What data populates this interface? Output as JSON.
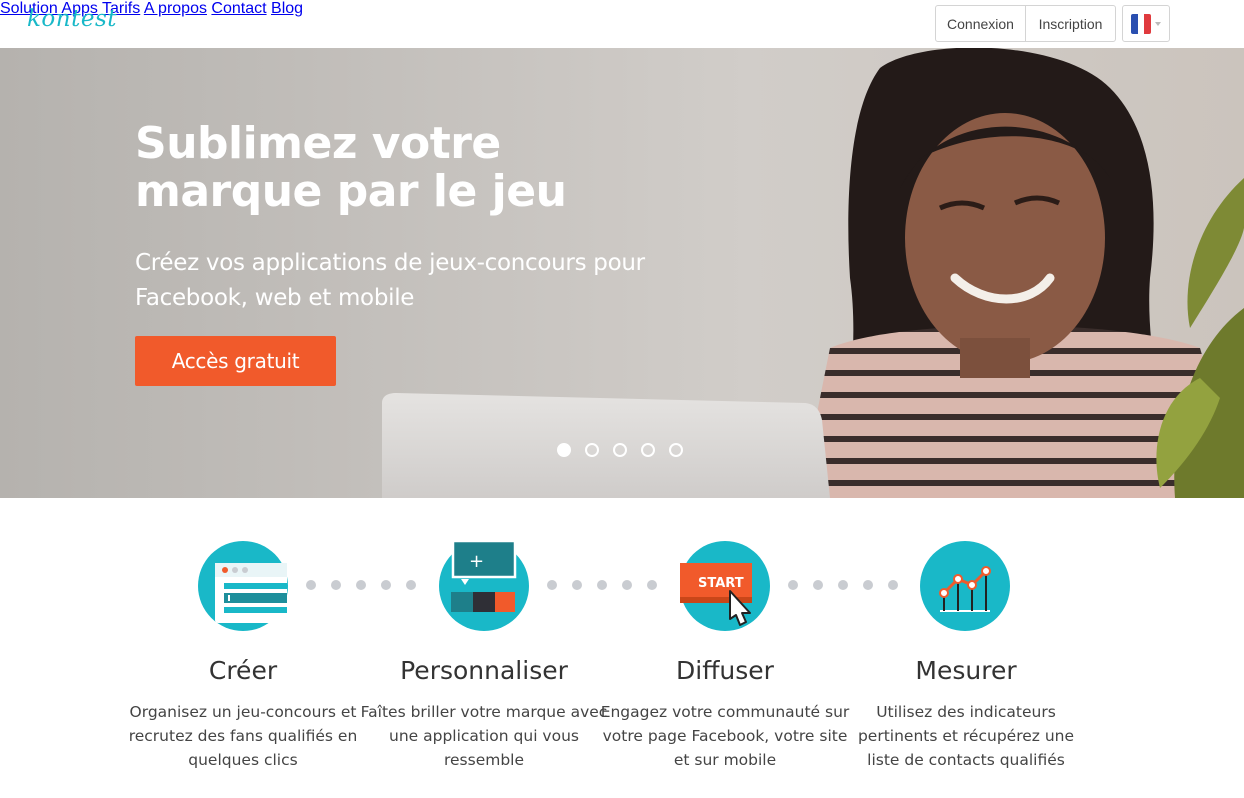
{
  "header": {
    "logo": "kontest",
    "nav": [
      "Solution",
      "Apps",
      "Tarifs",
      "A propos",
      "Contact",
      "Blog"
    ],
    "login_label": "Connexion",
    "signup_label": "Inscription",
    "language_flag": "france-flag-icon"
  },
  "hero": {
    "title": "Sublimez votre marque par le jeu",
    "subtitle": "Créez vos applications de jeux-concours pour Facebook, web et mobile",
    "cta_label": "Accès gratuit",
    "slides_count": 5,
    "active_slide": 1
  },
  "steps": [
    {
      "icon": "create-window-icon",
      "title": "Créer",
      "description": "Organisez un jeu-concours et recrutez des fans qualifiés en quelques clics"
    },
    {
      "icon": "customize-color-icon",
      "title": "Personnaliser",
      "description": "Faîtes briller votre marque avec une application qui vous ressemble"
    },
    {
      "icon": "start-button-icon",
      "title": "Diffuser",
      "description": "Engagez votre communauté sur votre page Facebook, votre site et sur mobile",
      "icon_text": "START"
    },
    {
      "icon": "chart-metrics-icon",
      "title": "Mesurer",
      "description": "Utilisez des indicateurs pertinents et récupérez une liste de contacts qualifiés"
    }
  ],
  "colors": {
    "accent": "#19b8c8",
    "cta": "#f15a2b",
    "connector": "#c9ccd1"
  }
}
